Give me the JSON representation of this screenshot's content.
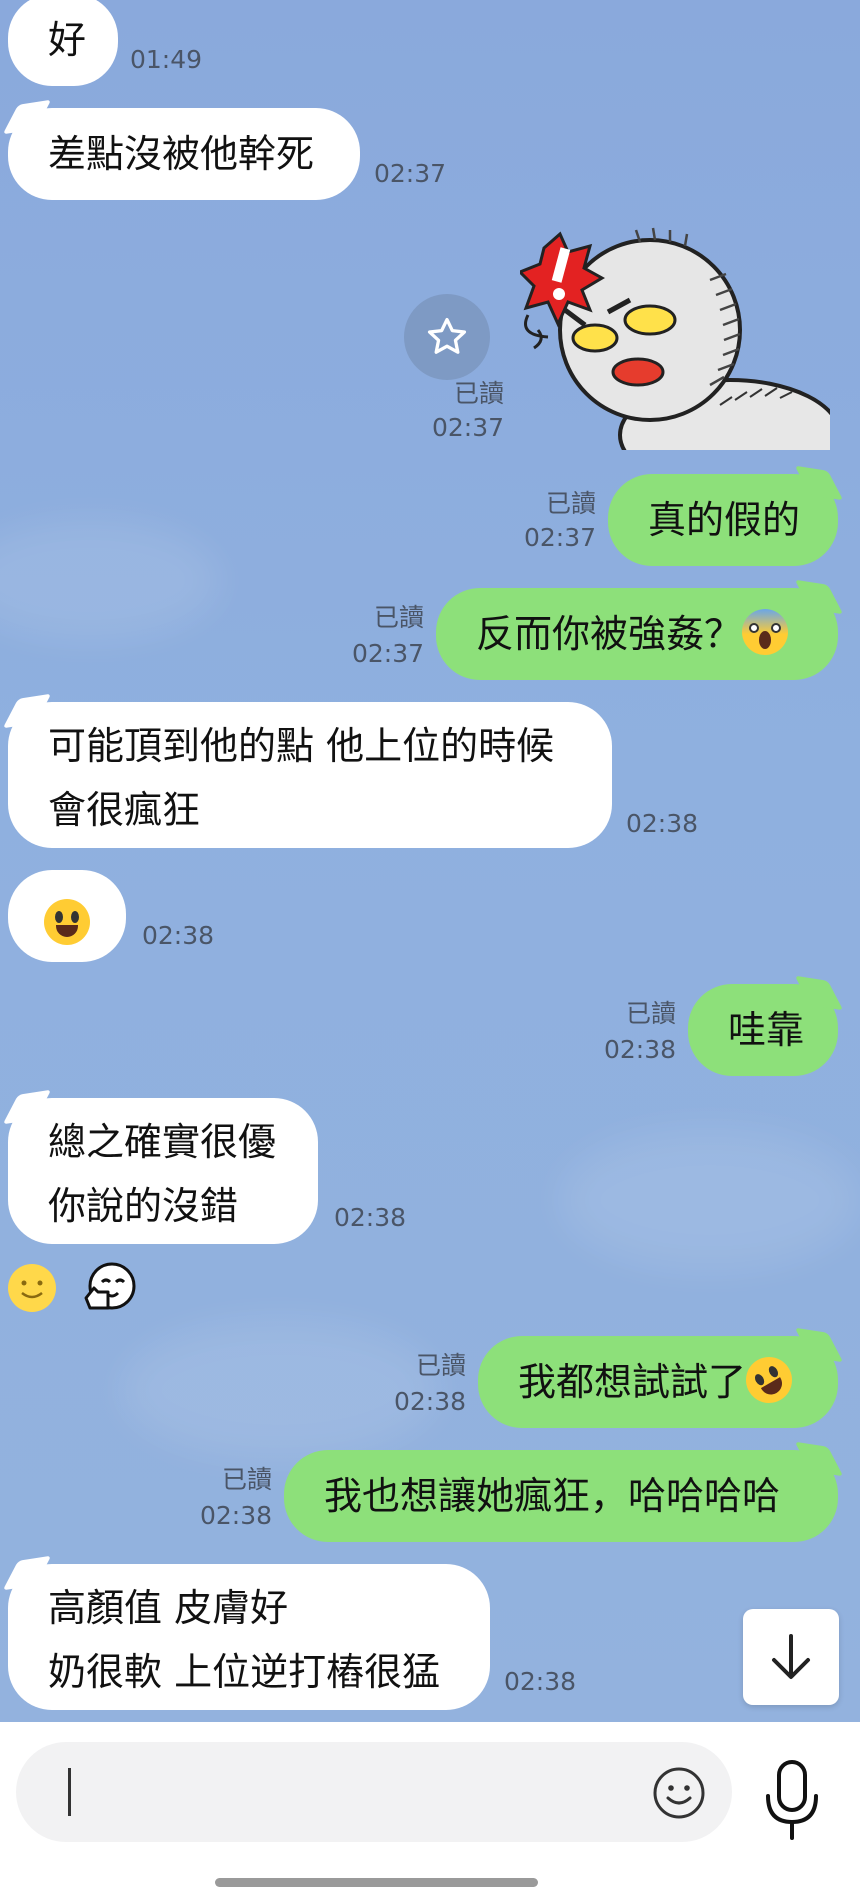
{
  "messages": [
    {
      "side": "in",
      "text": "好",
      "time": "01:49"
    },
    {
      "side": "in",
      "text": "差點沒被他幹死",
      "time": "02:37"
    },
    {
      "side": "out",
      "type": "sticker",
      "sticker": "angry-moon-sticker",
      "read": "已讀",
      "time": "02:37"
    },
    {
      "side": "out",
      "text": "真的假的",
      "read": "已讀",
      "time": "02:37"
    },
    {
      "side": "out",
      "text": "反而你被強姦？",
      "emoji": "scream-emoji",
      "read": "已讀",
      "time": "02:37"
    },
    {
      "side": "in",
      "lines": [
        "可能頂到他的點 他上位的時候",
        "會很瘋狂"
      ],
      "time": "02:38"
    },
    {
      "side": "in",
      "emoji": "laughing-tears-emoji",
      "time": "02:38"
    },
    {
      "side": "out",
      "text": "哇靠",
      "read": "已讀",
      "time": "02:38"
    },
    {
      "side": "in",
      "lines": [
        "總之確實很優",
        "你說的沒錯"
      ],
      "time": "02:38",
      "reactions": [
        "smile-emoji",
        "thumbs-up-face-emoji"
      ]
    },
    {
      "side": "out",
      "text": "我都想試試了",
      "emoji": "rofl-emoji",
      "read": "已讀",
      "time": "02:38"
    },
    {
      "side": "out",
      "text": "我也想讓她瘋狂，哈哈哈哈",
      "read": "已讀",
      "time": "02:38"
    },
    {
      "side": "in",
      "lines": [
        "高顏值 皮膚好",
        "奶很軟 上位逆打樁很猛"
      ],
      "time": "02:38"
    }
  ],
  "colors": {
    "background": "#8eacdc",
    "incoming": "#ffffff",
    "outgoing": "#8de07a"
  },
  "icons": {
    "star": "star-icon",
    "scroll": "arrow-down-icon",
    "emoji": "smiley-icon",
    "mic": "microphone-icon"
  }
}
